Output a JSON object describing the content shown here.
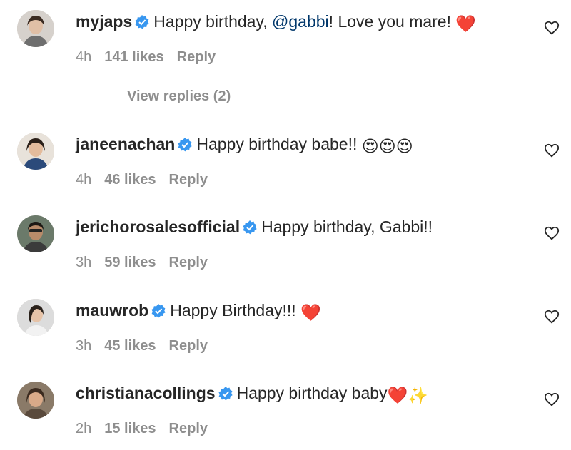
{
  "comments": [
    {
      "username": "myjaps",
      "text_before": "Happy birthday, ",
      "mention": "@gabbi",
      "text_after": "! Love you mare! ",
      "emoji": "❤️",
      "time": "4h",
      "likes": "141 likes",
      "reply": "Reply"
    },
    {
      "username": "janeenachan",
      "text": "Happy birthday babe!! ",
      "emoji": "😍😍😍",
      "time": "4h",
      "likes": "46 likes",
      "reply": "Reply"
    },
    {
      "username": "jerichorosalesofficial",
      "text": "Happy birthday, Gabbi!!",
      "time": "3h",
      "likes": "59 likes",
      "reply": "Reply"
    },
    {
      "username": "mauwrob",
      "text": "Happy Birthday!!! ",
      "emoji": "❤️",
      "time": "3h",
      "likes": "45 likes",
      "reply": "Reply"
    },
    {
      "username": "christianacollings",
      "text": "Happy birthday baby",
      "emoji": "❤️✨",
      "time": "2h",
      "likes": "15 likes",
      "reply": "Reply"
    }
  ],
  "view_replies": "View replies (2)",
  "colors": {
    "text": "#262626",
    "meta": "#8e8e8e",
    "mention": "#00376b",
    "verified": "#3897f0"
  },
  "icons": [
    "verified-badge-icon",
    "heart-outline-icon"
  ]
}
